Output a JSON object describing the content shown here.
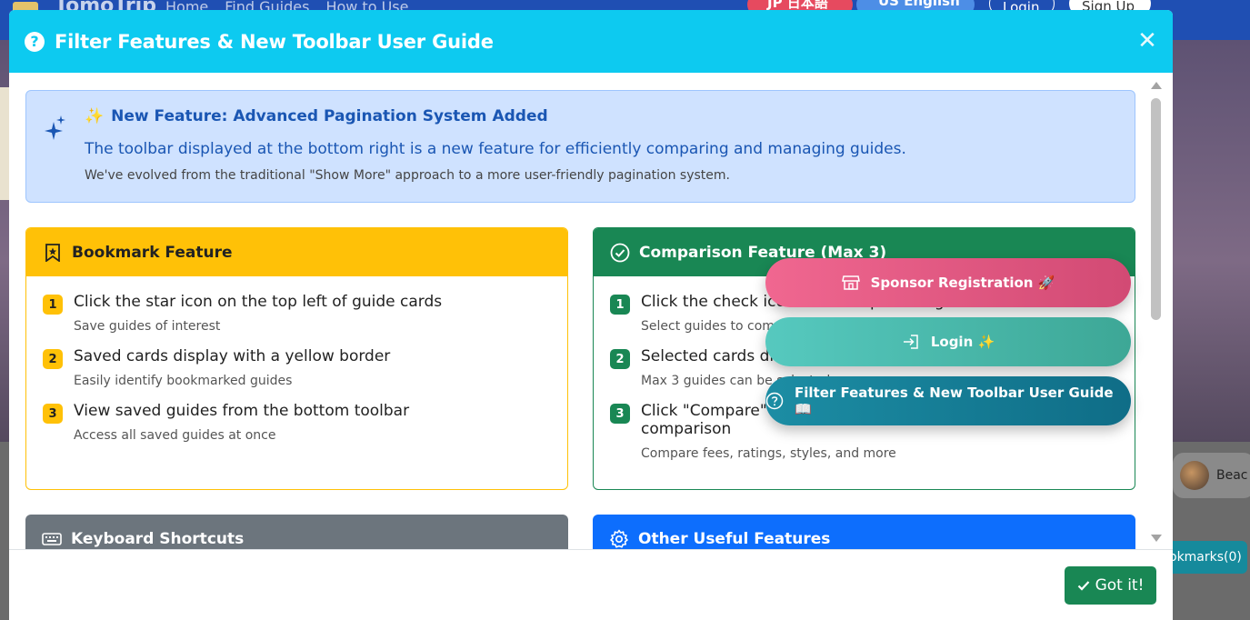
{
  "background": {
    "brand": "TomoTrip",
    "nav_links": [
      "Home",
      "Find Guides",
      "How to Use"
    ],
    "lang_jp": "JP 日本語",
    "lang_en": "US English",
    "login": "Login",
    "signup": "Sign Up",
    "card_chip_text": "Beac",
    "bookmarks_button": "okmarks(0)"
  },
  "modal": {
    "title": "Filter Features & New Toolbar User Guide",
    "close_symbol": "✕",
    "alert": {
      "emoji": "✨",
      "heading": "New Feature: Advanced Pagination System Added",
      "line1": "The toolbar displayed at the bottom right is a new feature for efficiently comparing and managing guides.",
      "line2": "We've evolved from the traditional \"Show More\" approach to a more user-friendly pagination system."
    },
    "bookmark": {
      "title": "Bookmark Feature",
      "items": [
        {
          "num": "1",
          "title": "Click the star icon on the top left of guide cards",
          "desc": "Save guides of interest"
        },
        {
          "num": "2",
          "title": "Saved cards display with a yellow border",
          "desc": "Easily identify bookmarked guides"
        },
        {
          "num": "3",
          "title": "View saved guides from the bottom toolbar",
          "desc": "Access all saved guides at once"
        }
      ]
    },
    "comparison": {
      "title": "Comparison Feature (Max 3)",
      "items": [
        {
          "num": "1",
          "title": "Click the check icon on the top left of guide cards",
          "desc": "Select guides to compare"
        },
        {
          "num": "2",
          "title": "Selected cards display with a green border",
          "desc": "Max 3 guides can be selected"
        },
        {
          "num": "3",
          "title": "Click \"Compare\" in the bottom toolbar for detailed comparison",
          "desc": "Compare fees, ratings, styles, and more"
        }
      ]
    },
    "keyboard": {
      "title": "Keyboard Shortcuts"
    },
    "other": {
      "title": "Other Useful Features"
    },
    "got_it": "Got it!"
  },
  "floating": {
    "sponsor": "Sponsor Registration 🚀",
    "login": "Login ✨",
    "guide": "Filter Features & New Toolbar User Guide 📖"
  },
  "colors": {
    "header": "#0dcaf0",
    "bookmark": "#ffc107",
    "comparison": "#198754",
    "keyboard": "#6c757d",
    "other": "#0d6efd"
  }
}
